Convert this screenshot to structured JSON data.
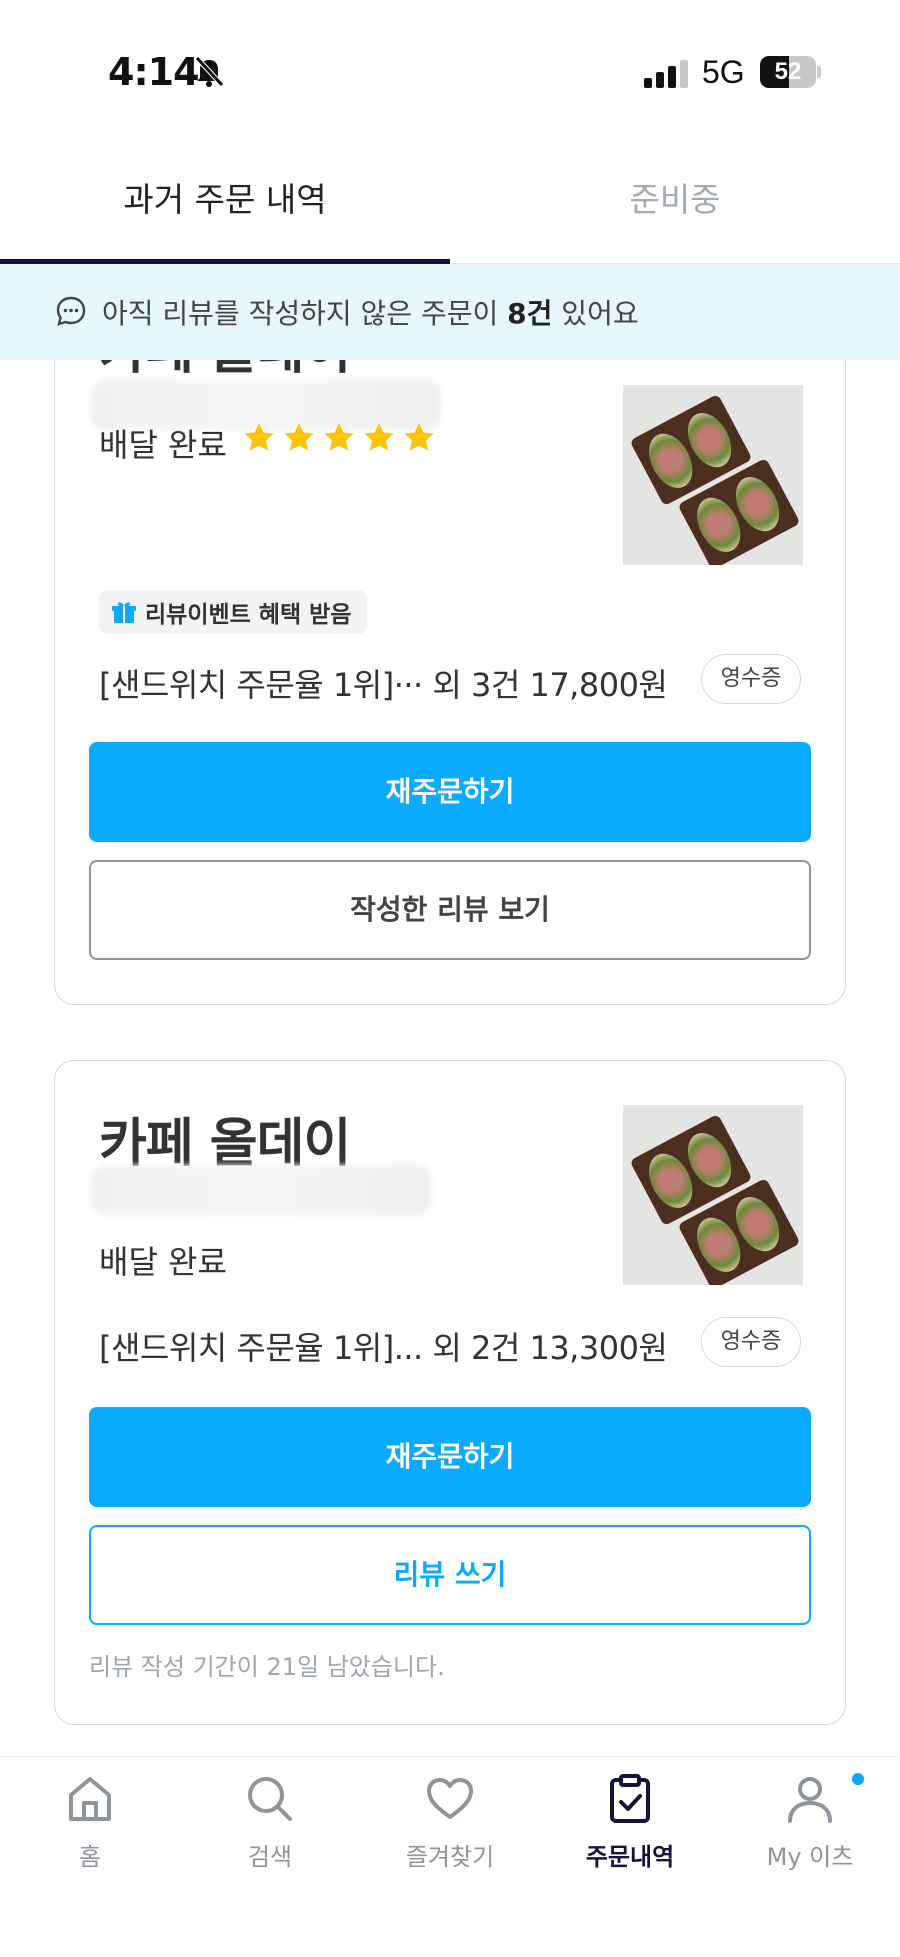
{
  "status_bar": {
    "time": "4:14",
    "network": "5G",
    "battery_text": "52",
    "battery_level": 0.52
  },
  "tabs": [
    {
      "label": "과거 주문 내역",
      "active": true
    },
    {
      "label": "준비중",
      "active": false
    }
  ],
  "notice": {
    "prefix": "아직 리뷰를 작성하지 않은 주문이 ",
    "count": "8건",
    "suffix": " 있어요"
  },
  "orders": [
    {
      "store_name": "카페 올데이",
      "status": "배달 완료",
      "rating": 5,
      "badge": "리뷰이벤트 혜택 받음",
      "order_summary": "[샌드위치 주문율 1위]··· 외 3건 17,800원",
      "receipt_label": "영수증",
      "primary_action": "재주문하기",
      "secondary_action": "작성한 리뷰 보기"
    },
    {
      "store_name": "카페 올데이",
      "status": "배달 완료",
      "order_summary": "[샌드위치 주문율 1위]... 외 2건 13,300원",
      "receipt_label": "영수증",
      "primary_action": "재주문하기",
      "secondary_action": "리뷰 쓰기",
      "review_deadline": "리뷰 작성 기간이 21일 남았습니다."
    }
  ],
  "bottom_nav": [
    {
      "label": "홈",
      "icon": "home-icon"
    },
    {
      "label": "검색",
      "icon": "search-icon"
    },
    {
      "label": "즐겨찾기",
      "icon": "heart-icon"
    },
    {
      "label": "주문내역",
      "icon": "clipboard-check-icon",
      "active": true
    },
    {
      "label": "My 이츠",
      "icon": "person-icon"
    }
  ],
  "colors": {
    "accent": "#0aaaff",
    "tab_indicator": "#14143a",
    "notice_bg": "#e8f6fd",
    "star": "#ffc400"
  }
}
